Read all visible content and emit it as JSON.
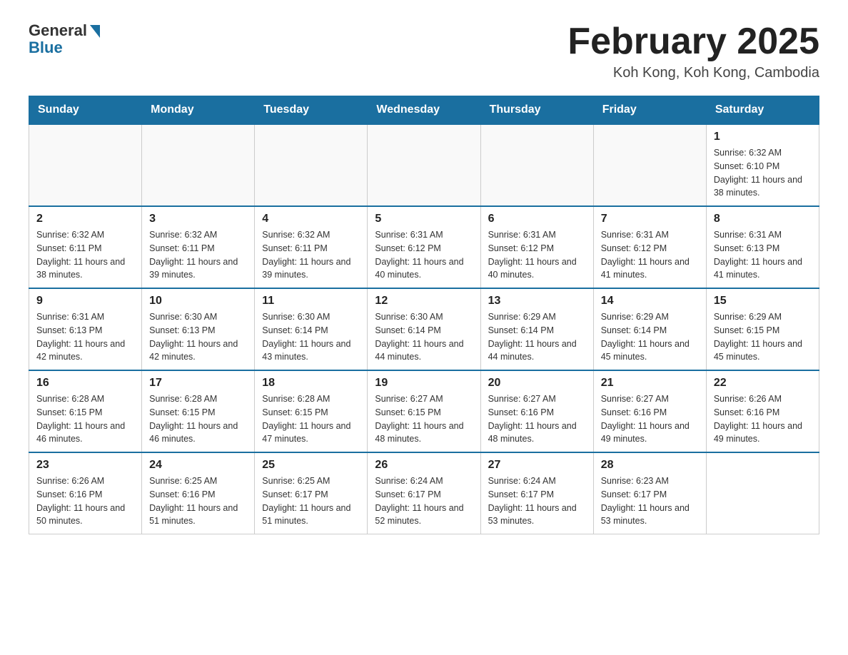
{
  "header": {
    "logo_general": "General",
    "logo_blue": "Blue",
    "month_title": "February 2025",
    "location": "Koh Kong, Koh Kong, Cambodia"
  },
  "weekdays": [
    "Sunday",
    "Monday",
    "Tuesday",
    "Wednesday",
    "Thursday",
    "Friday",
    "Saturday"
  ],
  "weeks": [
    [
      {
        "day": "",
        "info": ""
      },
      {
        "day": "",
        "info": ""
      },
      {
        "day": "",
        "info": ""
      },
      {
        "day": "",
        "info": ""
      },
      {
        "day": "",
        "info": ""
      },
      {
        "day": "",
        "info": ""
      },
      {
        "day": "1",
        "info": "Sunrise: 6:32 AM\nSunset: 6:10 PM\nDaylight: 11 hours and 38 minutes."
      }
    ],
    [
      {
        "day": "2",
        "info": "Sunrise: 6:32 AM\nSunset: 6:11 PM\nDaylight: 11 hours and 38 minutes."
      },
      {
        "day": "3",
        "info": "Sunrise: 6:32 AM\nSunset: 6:11 PM\nDaylight: 11 hours and 39 minutes."
      },
      {
        "day": "4",
        "info": "Sunrise: 6:32 AM\nSunset: 6:11 PM\nDaylight: 11 hours and 39 minutes."
      },
      {
        "day": "5",
        "info": "Sunrise: 6:31 AM\nSunset: 6:12 PM\nDaylight: 11 hours and 40 minutes."
      },
      {
        "day": "6",
        "info": "Sunrise: 6:31 AM\nSunset: 6:12 PM\nDaylight: 11 hours and 40 minutes."
      },
      {
        "day": "7",
        "info": "Sunrise: 6:31 AM\nSunset: 6:12 PM\nDaylight: 11 hours and 41 minutes."
      },
      {
        "day": "8",
        "info": "Sunrise: 6:31 AM\nSunset: 6:13 PM\nDaylight: 11 hours and 41 minutes."
      }
    ],
    [
      {
        "day": "9",
        "info": "Sunrise: 6:31 AM\nSunset: 6:13 PM\nDaylight: 11 hours and 42 minutes."
      },
      {
        "day": "10",
        "info": "Sunrise: 6:30 AM\nSunset: 6:13 PM\nDaylight: 11 hours and 42 minutes."
      },
      {
        "day": "11",
        "info": "Sunrise: 6:30 AM\nSunset: 6:14 PM\nDaylight: 11 hours and 43 minutes."
      },
      {
        "day": "12",
        "info": "Sunrise: 6:30 AM\nSunset: 6:14 PM\nDaylight: 11 hours and 44 minutes."
      },
      {
        "day": "13",
        "info": "Sunrise: 6:29 AM\nSunset: 6:14 PM\nDaylight: 11 hours and 44 minutes."
      },
      {
        "day": "14",
        "info": "Sunrise: 6:29 AM\nSunset: 6:14 PM\nDaylight: 11 hours and 45 minutes."
      },
      {
        "day": "15",
        "info": "Sunrise: 6:29 AM\nSunset: 6:15 PM\nDaylight: 11 hours and 45 minutes."
      }
    ],
    [
      {
        "day": "16",
        "info": "Sunrise: 6:28 AM\nSunset: 6:15 PM\nDaylight: 11 hours and 46 minutes."
      },
      {
        "day": "17",
        "info": "Sunrise: 6:28 AM\nSunset: 6:15 PM\nDaylight: 11 hours and 46 minutes."
      },
      {
        "day": "18",
        "info": "Sunrise: 6:28 AM\nSunset: 6:15 PM\nDaylight: 11 hours and 47 minutes."
      },
      {
        "day": "19",
        "info": "Sunrise: 6:27 AM\nSunset: 6:15 PM\nDaylight: 11 hours and 48 minutes."
      },
      {
        "day": "20",
        "info": "Sunrise: 6:27 AM\nSunset: 6:16 PM\nDaylight: 11 hours and 48 minutes."
      },
      {
        "day": "21",
        "info": "Sunrise: 6:27 AM\nSunset: 6:16 PM\nDaylight: 11 hours and 49 minutes."
      },
      {
        "day": "22",
        "info": "Sunrise: 6:26 AM\nSunset: 6:16 PM\nDaylight: 11 hours and 49 minutes."
      }
    ],
    [
      {
        "day": "23",
        "info": "Sunrise: 6:26 AM\nSunset: 6:16 PM\nDaylight: 11 hours and 50 minutes."
      },
      {
        "day": "24",
        "info": "Sunrise: 6:25 AM\nSunset: 6:16 PM\nDaylight: 11 hours and 51 minutes."
      },
      {
        "day": "25",
        "info": "Sunrise: 6:25 AM\nSunset: 6:17 PM\nDaylight: 11 hours and 51 minutes."
      },
      {
        "day": "26",
        "info": "Sunrise: 6:24 AM\nSunset: 6:17 PM\nDaylight: 11 hours and 52 minutes."
      },
      {
        "day": "27",
        "info": "Sunrise: 6:24 AM\nSunset: 6:17 PM\nDaylight: 11 hours and 53 minutes."
      },
      {
        "day": "28",
        "info": "Sunrise: 6:23 AM\nSunset: 6:17 PM\nDaylight: 11 hours and 53 minutes."
      },
      {
        "day": "",
        "info": ""
      }
    ]
  ]
}
